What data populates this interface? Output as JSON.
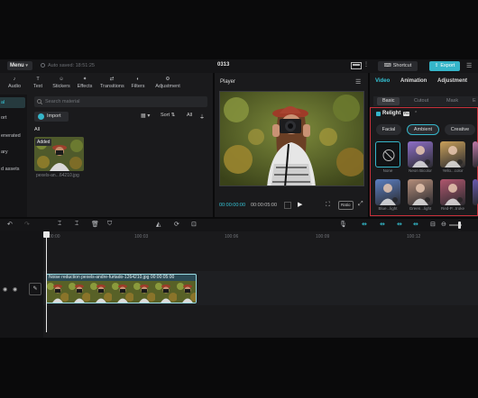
{
  "topbar": {
    "menu_label": "Menu",
    "autosave": "Auto saved: 18:51:25",
    "project_title": "0313",
    "shortcut_label": "Shortcut",
    "export_label": "Export"
  },
  "media_tools": [
    {
      "label": "Audio",
      "icon": "audio-icon"
    },
    {
      "label": "Text",
      "icon": "text-icon"
    },
    {
      "label": "Stickers",
      "icon": "stickers-icon"
    },
    {
      "label": "Effects",
      "icon": "effects-icon"
    },
    {
      "label": "Transitions",
      "icon": "transitions-icon"
    },
    {
      "label": "Filters",
      "icon": "filters-icon"
    },
    {
      "label": "Adjustment",
      "icon": "adjustment-icon"
    }
  ],
  "side_nav": [
    {
      "label": "al",
      "active": true
    },
    {
      "label": "ort",
      "active": false
    },
    {
      "label": "enerated",
      "active": false
    },
    {
      "label": "ary",
      "active": false
    },
    {
      "label": "d assets",
      "active": false
    }
  ],
  "media": {
    "search_placeholder": "Search material",
    "import_label": "Import",
    "sort_label": "Sort",
    "all_label": "All",
    "section_label": "All",
    "added_badge": "Added",
    "filename": "pexels-an...64210.jpg"
  },
  "player": {
    "title": "Player",
    "time_current": "00:00:00:00",
    "time_total": "00:00:05:00",
    "ratio_label": "Ratio"
  },
  "props": {
    "tabs": [
      {
        "label": "Video",
        "active": true
      },
      {
        "label": "Animation",
        "active": false
      },
      {
        "label": "Adjustment",
        "active": false
      }
    ],
    "subtabs": [
      {
        "label": "Basic",
        "active": true
      },
      {
        "label": "Cutout",
        "active": false
      },
      {
        "label": "Mask",
        "active": false
      },
      {
        "label": "E",
        "active": false
      }
    ],
    "relight_label": "Relight",
    "pro_badge": "Pro",
    "chips": [
      {
        "label": "Facial",
        "active": false
      },
      {
        "label": "Ambient",
        "active": true
      },
      {
        "label": "Creative",
        "active": false
      }
    ],
    "presets": [
      {
        "label": "None",
        "color": "#111214"
      },
      {
        "label": "Neon Bicolor",
        "color": "#8f6fc8"
      },
      {
        "label": "Yello...color",
        "color": "#c9a05a"
      },
      {
        "label": "Pink",
        "color": "#c07aa8"
      },
      {
        "label": "Blue...light",
        "color": "#5b7fc2"
      },
      {
        "label": "Green...light",
        "color": "#b58e7a"
      },
      {
        "label": "Red-P...troke",
        "color": "#b0566d"
      },
      {
        "label": "",
        "color": "#6a5ab0"
      }
    ]
  },
  "timeline": {
    "ruler": [
      "00:00",
      "100:03",
      "100:06",
      "100:09",
      "100:12"
    ],
    "clip_label": "Noise reduction  pexels-andre-furtado-1264210.jpg  00:00:05:00"
  },
  "colors": {
    "accent": "#35b5c9",
    "highlight_border": "#c7303a",
    "panel": "#1a1a1c"
  }
}
